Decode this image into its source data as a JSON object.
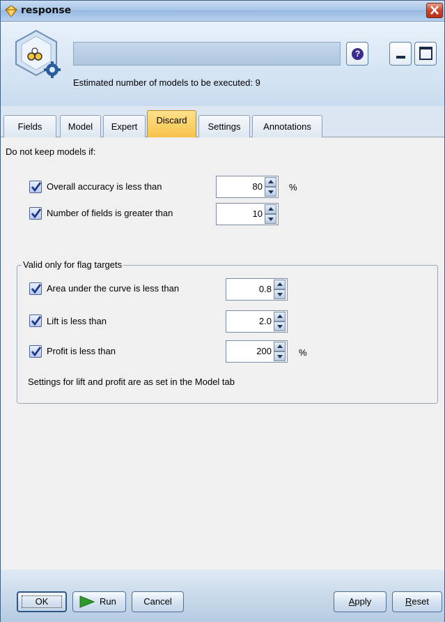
{
  "window": {
    "title": "response",
    "estimate_text": "Estimated number of models to be executed: 9"
  },
  "tabs": [
    {
      "label": "Fields"
    },
    {
      "label": "Model"
    },
    {
      "label": "Expert"
    },
    {
      "label": "Discard",
      "active": true
    },
    {
      "label": "Settings"
    },
    {
      "label": "Annotations"
    }
  ],
  "discard": {
    "heading": "Do not keep models if:",
    "accuracy": {
      "label": "Overall accuracy is less than",
      "checked": true,
      "value": "80",
      "unit": "%"
    },
    "fields": {
      "label": "Number of fields is greater than",
      "checked": true,
      "value": "10"
    },
    "flag_group": {
      "legend": "Valid only for flag targets",
      "auc": {
        "label": "Area under the curve is less than",
        "checked": true,
        "value": "0.8"
      },
      "lift": {
        "label": "Lift is less than",
        "checked": true,
        "value": "2.0"
      },
      "profit": {
        "label": "Profit is less than",
        "checked": true,
        "value": "200",
        "unit": "%"
      },
      "note": "Settings for lift and profit are as set in the Model tab"
    }
  },
  "buttons": {
    "ok": "OK",
    "run": "Run",
    "cancel": "Cancel",
    "apply_prefix": "",
    "apply_u": "A",
    "apply_rest": "pply",
    "reset_prefix": "",
    "reset_u": "R",
    "reset_rest": "eset"
  },
  "icons": {
    "title": "diamond-node-icon",
    "node": "model-node-icon",
    "help": "help-icon",
    "minimize": "minimize-icon",
    "maximize": "maximize-icon",
    "close": "close-icon",
    "run": "play-icon"
  },
  "colors": {
    "active_tab": "#f7c24a",
    "titlebar": "#a9c6e8",
    "close": "#c9452a",
    "run_icon": "#2e9a2a"
  }
}
